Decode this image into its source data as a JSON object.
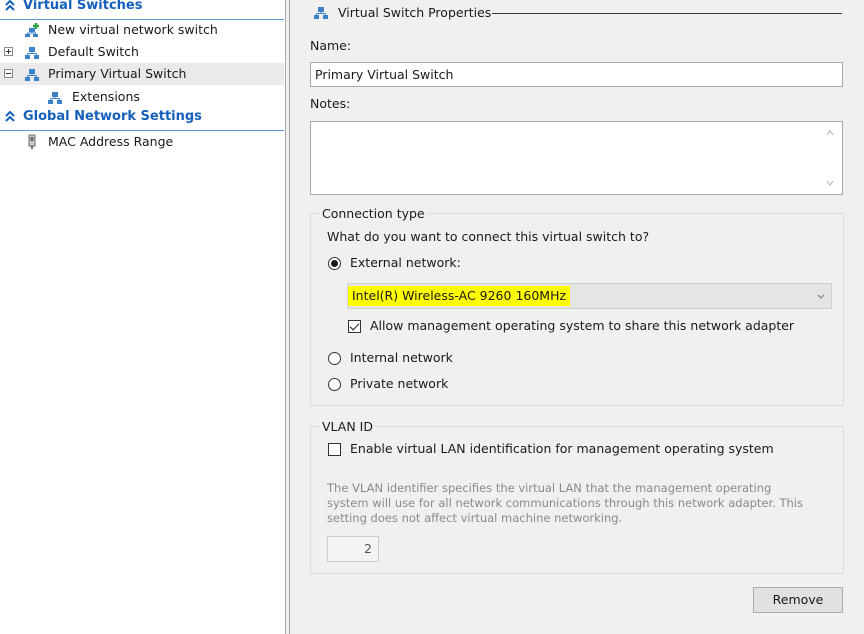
{
  "tree": {
    "virtual_switches_header": "Virtual Switches",
    "new_switch": "New virtual network switch",
    "default_switch": "Default Switch",
    "primary_switch": "Primary Virtual Switch",
    "extensions": "Extensions",
    "global_header": "Global Network Settings",
    "mac_range": "MAC Address Range"
  },
  "properties": {
    "section_title": "Virtual Switch Properties",
    "name_label": "Name:",
    "name_value": "Primary Virtual Switch",
    "notes_label": "Notes:",
    "notes_value": ""
  },
  "connection": {
    "group_title": "Connection type",
    "question": "What do you want to connect this virtual switch to?",
    "external_label": "External network:",
    "external_checked": true,
    "adapter_value": "Intel(R) Wireless-AC 9260 160MHz",
    "share_label": "Allow management operating system to share this network adapter",
    "share_checked": true,
    "internal_label": "Internal network",
    "private_label": "Private network"
  },
  "vlan": {
    "group_title": "VLAN ID",
    "enable_label": "Enable virtual LAN identification for management operating system",
    "enable_checked": false,
    "description_line1": "The VLAN identifier specifies the virtual LAN that the management operating",
    "description_line2": "system will use for all network communications through this network adapter. This",
    "description_line3": "setting does not affect virtual machine networking.",
    "vlan_value": "2"
  },
  "buttons": {
    "remove": "Remove"
  },
  "colors": {
    "header_blue": "#1560bd",
    "highlight": "#ffff00",
    "pane_background": "#f0f0f0",
    "selected_row": "#eaeaea"
  },
  "icons": {
    "section_chevron": "double-chevron-up-icon",
    "switch": "network-switch-icon",
    "new_switch": "new-network-switch-icon",
    "mac": "network-adapter-icon"
  }
}
